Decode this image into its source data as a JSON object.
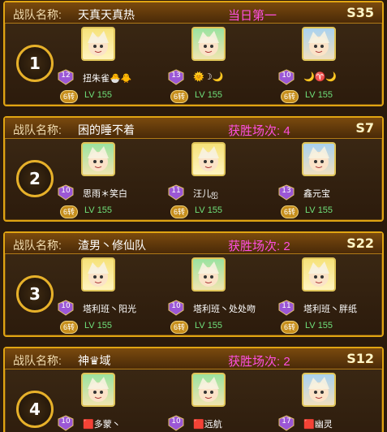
{
  "teams": [
    {
      "name_label": "战队名称:",
      "team_name": "天真天真热",
      "result": "当日第一",
      "server": "S35",
      "rank": "1",
      "members": [
        {
          "name": "扭朱雀🐣🐥",
          "badge": "12",
          "zhuan": "6转",
          "level": "LV 155",
          "portrait": "yellow"
        },
        {
          "name": "🌞☽🌙",
          "badge": "13",
          "zhuan": "6转",
          "level": "LV 155",
          "portrait": "green"
        },
        {
          "name": "🌙♈🌙",
          "badge": "10",
          "zhuan": "6转",
          "level": "LV 155",
          "portrait": "blue"
        }
      ]
    },
    {
      "name_label": "战队名称:",
      "team_name": "困的睡不着",
      "result": "获胜场次: 4",
      "server": "S7",
      "rank": "2",
      "members": [
        {
          "name": "思雨＊笑白",
          "badge": "10",
          "zhuan": "6转",
          "level": "LV 155",
          "portrait": "green"
        },
        {
          "name": "汪儿ஐ",
          "badge": "11",
          "zhuan": "6转",
          "level": "LV 155",
          "portrait": "yellow"
        },
        {
          "name": "鑫元宝",
          "badge": "13",
          "zhuan": "6转",
          "level": "LV 155",
          "portrait": "blue"
        }
      ]
    },
    {
      "name_label": "战队名称:",
      "team_name": "渣男丶修仙队",
      "result": "获胜场次: 2",
      "server": "S22",
      "rank": "3",
      "members": [
        {
          "name": "塔利班丶阳光",
          "badge": "10",
          "zhuan": "6转",
          "level": "LV 155",
          "portrait": "yellow"
        },
        {
          "name": "塔利班丶处处吻",
          "badge": "10",
          "zhuan": "6转",
          "level": "LV 155",
          "portrait": "green"
        },
        {
          "name": "塔利班丶胖纸",
          "badge": "11",
          "zhuan": "6转",
          "level": "LV 155",
          "portrait": "yellow"
        }
      ]
    },
    {
      "name_label": "战队名称:",
      "team_name": "神♛域",
      "result": "获胜场次: 2",
      "server": "S12",
      "rank": "4",
      "members": [
        {
          "name": "🟥多蒙丶",
          "badge": "10",
          "zhuan": "",
          "level": "",
          "portrait": "green"
        },
        {
          "name": "🟥远航",
          "badge": "10",
          "zhuan": "",
          "level": "",
          "portrait": "green"
        },
        {
          "name": "🟥幽灵",
          "badge": "17",
          "zhuan": "",
          "level": "",
          "portrait": "blue"
        }
      ]
    }
  ],
  "colors": {
    "accent": "#e0a412",
    "result": "#ff4fe0",
    "level": "#6fe07a"
  }
}
